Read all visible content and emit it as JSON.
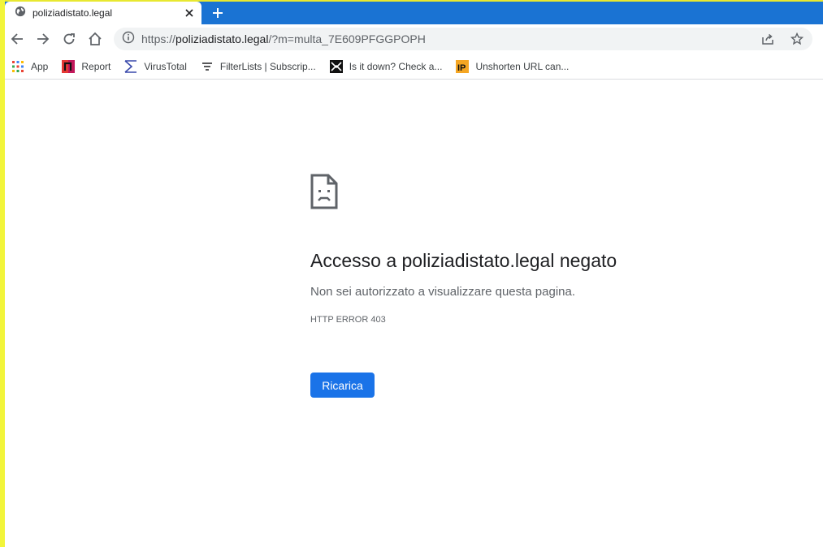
{
  "tab": {
    "title": "poliziadistato.legal"
  },
  "address_bar": {
    "scheme": "https://",
    "host": "poliziadistato.legal",
    "path": "/?m=multa_7E609PFGGPOPH"
  },
  "bookmarks": [
    {
      "label": "App",
      "icon": "apps-grid-icon"
    },
    {
      "label": "Report",
      "icon": "report-icon"
    },
    {
      "label": "VirusTotal",
      "icon": "virustotal-icon"
    },
    {
      "label": "FilterLists | Subscrip...",
      "icon": "filter-icon"
    },
    {
      "label": "Is it down? Check a...",
      "icon": "isitdown-icon"
    },
    {
      "label": "Unshorten URL can...",
      "icon": "ip-icon"
    }
  ],
  "error": {
    "title": "Accesso a poliziadistato.legal negato",
    "description": "Non sei autorizzato a visualizzare questa pagina.",
    "code": "HTTP ERROR 403",
    "button_label": "Ricarica"
  },
  "colors": {
    "tabstrip": "#1a73d3",
    "accent": "#1a73e8",
    "left_edge": "#f2f53a"
  }
}
